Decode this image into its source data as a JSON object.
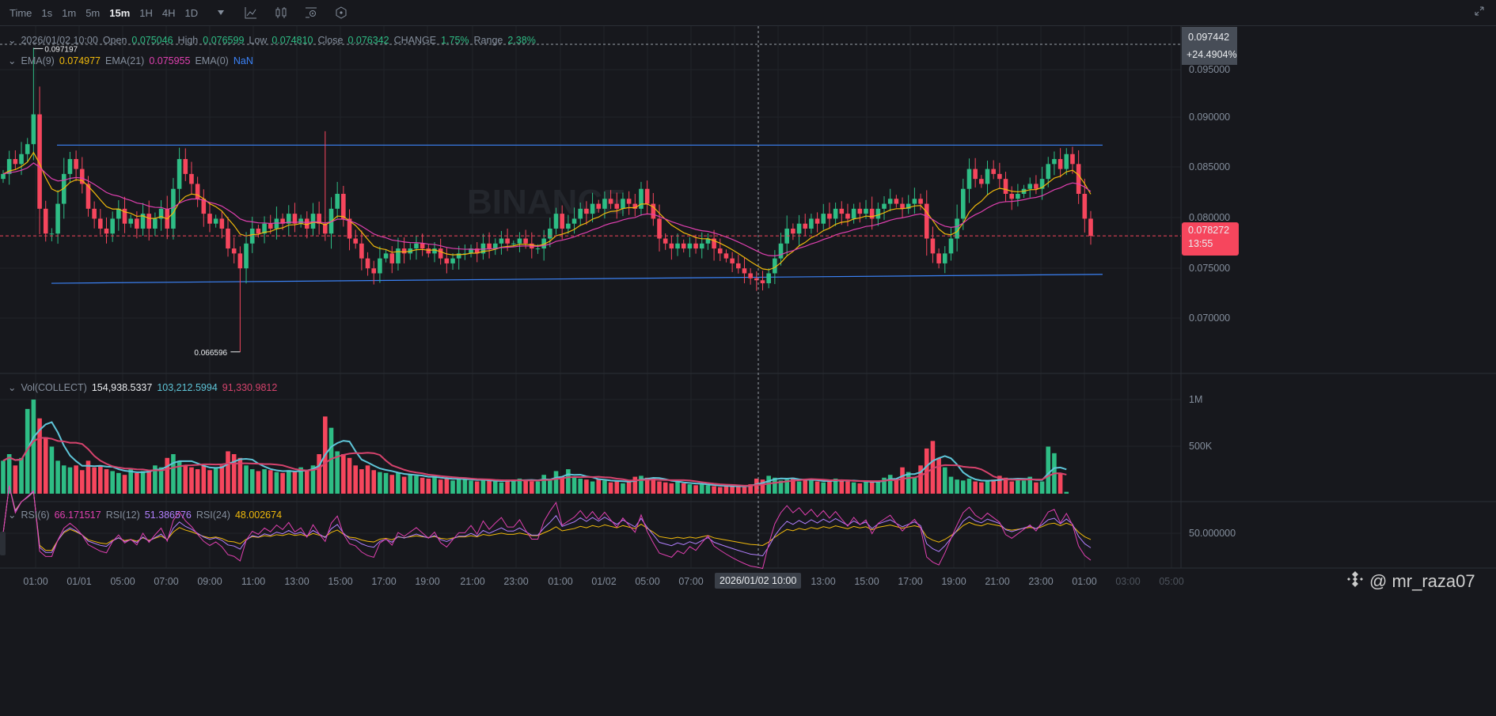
{
  "toolbar": {
    "timeframes": [
      "Time",
      "1s",
      "1m",
      "5m",
      "15m",
      "1H",
      "4H",
      "1D"
    ],
    "active": "15m"
  },
  "ohlc_legend": {
    "datetime": "2026/01/02 10:00",
    "open_label": "Open",
    "open": "0.075046",
    "high_label": "High",
    "high": "0.076599",
    "low_label": "Low",
    "low": "0.074810",
    "close_label": "Close",
    "close": "0.076342",
    "change_label": "CHANGE",
    "change": "1.75%",
    "range_label": "Range",
    "range": "2.38%"
  },
  "ema_legend": {
    "ema9_label": "EMA(9)",
    "ema9": "0.074977",
    "ema21_label": "EMA(21)",
    "ema21": "0.075955",
    "ema0_label": "EMA(0)",
    "ema0": "NaN"
  },
  "vol_legend": {
    "label": "Vol(COLLECT)",
    "v1": "154,938.5337",
    "v2": "103,212.5994",
    "v3": "91,330.9812"
  },
  "rsi_legend": {
    "rsi6_label": "RSI(6)",
    "rsi6": "66.171517",
    "rsi12_label": "RSI(12)",
    "rsi12": "51.386576",
    "rsi24_label": "RSI(24)",
    "rsi24": "48.002674"
  },
  "price_axis": [
    "0.095000",
    "0.090000",
    "0.085000",
    "0.080000",
    "0.075000",
    "0.070000"
  ],
  "vol_axis": [
    "1M",
    "500K"
  ],
  "rsi_axis": [
    "50.000000"
  ],
  "crosshair": {
    "price": "0.097442",
    "pct": "+24.4904%",
    "time": "2026/01/02 10:00"
  },
  "last_price": {
    "price": "0.078272",
    "countdown": "13:55"
  },
  "annotations": {
    "high": "0.097197",
    "low": "0.066596"
  },
  "watermark": {
    "logo": "BINANCE",
    "user": "@ mr_raza07"
  },
  "time_axis": [
    "01:00",
    "01/01",
    "05:00",
    "07:00",
    "09:00",
    "11:00",
    "13:00",
    "15:00",
    "17:00",
    "19:00",
    "21:00",
    "23:00",
    "01:00",
    "01/02",
    "05:00",
    "07:00",
    "13:00",
    "15:00",
    "17:00",
    "19:00",
    "21:00",
    "23:00",
    "01:00",
    "03:00",
    "05:00"
  ],
  "colors": {
    "up": "#2ebd85",
    "down": "#f6465d",
    "ema9": "#f0b90b",
    "ema21": "#e040b0",
    "trend": "#3b82f6",
    "vma1": "#5ec5d8",
    "vma2": "#d6436d",
    "rsi6": "#e040b0",
    "rsi12": "#b380ff",
    "rsi24": "#f0b90b"
  },
  "chart_data": {
    "type": "candlestick",
    "interval": "15m",
    "price_range": [
      0.064,
      0.099
    ],
    "trendlines": [
      {
        "from": 0.0874,
        "to": 0.0874
      },
      {
        "from": 0.0735,
        "to": 0.0744
      }
    ],
    "closes": [
      0.0845,
      0.086,
      0.0855,
      0.0865,
      0.0875,
      0.0905,
      0.081,
      0.0785,
      0.0785,
      0.0815,
      0.0845,
      0.086,
      0.085,
      0.0835,
      0.081,
      0.08,
      0.079,
      0.0785,
      0.08,
      0.081,
      0.0795,
      0.08,
      0.079,
      0.0805,
      0.079,
      0.08,
      0.081,
      0.079,
      0.083,
      0.086,
      0.0845,
      0.0835,
      0.082,
      0.0805,
      0.0795,
      0.08,
      0.079,
      0.077,
      0.0765,
      0.075,
      0.0775,
      0.079,
      0.0785,
      0.0795,
      0.079,
      0.08,
      0.0795,
      0.0805,
      0.0795,
      0.08,
      0.079,
      0.0805,
      0.0795,
      0.0785,
      0.081,
      0.0825,
      0.08,
      0.078,
      0.0775,
      0.076,
      0.075,
      0.0745,
      0.076,
      0.0765,
      0.0755,
      0.077,
      0.0765,
      0.077,
      0.0775,
      0.077,
      0.0765,
      0.077,
      0.076,
      0.0755,
      0.076,
      0.0765,
      0.0765,
      0.077,
      0.0765,
      0.0775,
      0.077,
      0.0775,
      0.078,
      0.0775,
      0.0775,
      0.078,
      0.0775,
      0.077,
      0.077,
      0.078,
      0.079,
      0.0805,
      0.079,
      0.0795,
      0.08,
      0.081,
      0.0805,
      0.0815,
      0.081,
      0.082,
      0.0815,
      0.081,
      0.082,
      0.0815,
      0.081,
      0.083,
      0.0815,
      0.08,
      0.078,
      0.0775,
      0.077,
      0.0775,
      0.077,
      0.0775,
      0.077,
      0.0775,
      0.078,
      0.077,
      0.0765,
      0.076,
      0.0755,
      0.075,
      0.0745,
      0.074,
      0.0738,
      0.0735,
      0.0745,
      0.076,
      0.0775,
      0.079,
      0.0785,
      0.0795,
      0.079,
      0.08,
      0.0795,
      0.0805,
      0.08,
      0.081,
      0.0805,
      0.08,
      0.081,
      0.0805,
      0.081,
      0.08,
      0.081,
      0.0815,
      0.082,
      0.0815,
      0.081,
      0.0815,
      0.082,
      0.0815,
      0.078,
      0.0765,
      0.0755,
      0.0765,
      0.078,
      0.08,
      0.083,
      0.085,
      0.084,
      0.0835,
      0.085,
      0.0845,
      0.084,
      0.0825,
      0.082,
      0.0825,
      0.083,
      0.0835,
      0.083,
      0.084,
      0.0855,
      0.086,
      0.085,
      0.0865,
      0.0855,
      0.0825,
      0.08,
      0.07827
    ],
    "special_wicks": {
      "high_index": 5,
      "high": 0.097197,
      "low_index": 39,
      "low": 0.066596,
      "spike_index": 53,
      "spike": 0.0888
    },
    "volume_k": [
      350,
      420,
      300,
      380,
      900,
      1000,
      800,
      600,
      500,
      350,
      300,
      280,
      300,
      250,
      350,
      280,
      300,
      260,
      240,
      220,
      200,
      260,
      220,
      240,
      250,
      300,
      280,
      380,
      420,
      350,
      300,
      280,
      260,
      300,
      250,
      280,
      300,
      450,
      420,
      380,
      300,
      260,
      240,
      260,
      250,
      230,
      220,
      250,
      230,
      280,
      250,
      300,
      420,
      820,
      700,
      450,
      420,
      380,
      300,
      260,
      300,
      250,
      230,
      220,
      200,
      220,
      180,
      200,
      190,
      170,
      160,
      180,
      150,
      160,
      140,
      170,
      150,
      140,
      130,
      150,
      140,
      130,
      120,
      150,
      150,
      160,
      140,
      130,
      130,
      200,
      150,
      240,
      180,
      260,
      170,
      160,
      150,
      130,
      160,
      140,
      120,
      130,
      110,
      140,
      180,
      190,
      170,
      160,
      130,
      120,
      110,
      130,
      110,
      100,
      90,
      100,
      90,
      80,
      70,
      80,
      80,
      90,
      70,
      100,
      160,
      150,
      190,
      170,
      140,
      150,
      170,
      130,
      150,
      140,
      130,
      120,
      140,
      160,
      150,
      130,
      120,
      110,
      140,
      130,
      130,
      170,
      200,
      160,
      280,
      230,
      170,
      300,
      480,
      560,
      380,
      280,
      180,
      150,
      140,
      160,
      130,
      120,
      140,
      150,
      190,
      170,
      130,
      160,
      140,
      180,
      120,
      130,
      500,
      430,
      210,
      20
    ]
  }
}
